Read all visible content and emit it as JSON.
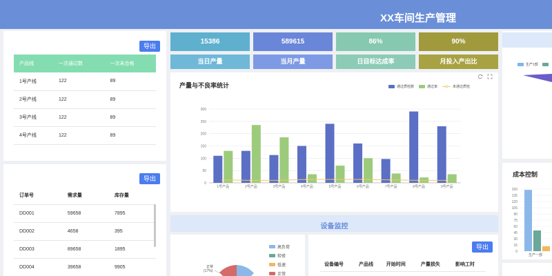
{
  "header": {
    "title": "XX车间生产管理"
  },
  "left_top": {
    "export_label": "导出",
    "columns": [
      "产品线",
      "一次通过数",
      "一次未合格"
    ],
    "rows": [
      [
        "1号产线",
        "122",
        "89"
      ],
      [
        "2号产线",
        "122",
        "89"
      ],
      [
        "3号产线",
        "122",
        "89"
      ],
      [
        "4号产线",
        "122",
        "89"
      ]
    ]
  },
  "left_bottom": {
    "export_label": "导出",
    "columns": [
      "订单号",
      "需求量",
      "库存量"
    ],
    "rows": [
      [
        "DD001",
        "59658",
        "7895"
      ],
      [
        "DD002",
        "4658",
        "395"
      ],
      [
        "DD003",
        "89658",
        "1895"
      ],
      [
        "DD004",
        "39658",
        "9905"
      ]
    ]
  },
  "kpis": [
    {
      "value": "15386",
      "label": "当日产量",
      "color": "#5fb0cf",
      "label_color": "#6fb8d8"
    },
    {
      "value": "589615",
      "label": "当月产量",
      "color": "#6a86d8",
      "label_color": "#7e9ae4"
    },
    {
      "value": "86%",
      "label": "日目标达成率",
      "color": "#86c9b0",
      "label_color": "#8ccbb5"
    },
    {
      "value": "90%",
      "label": "月投入产出比",
      "color": "#a09a3c",
      "label_color": "#a8a242"
    }
  ],
  "main_chart": {
    "title": "产量与不良率统计",
    "refresh_icon": "refresh-icon",
    "expand_icon": "expand-icon"
  },
  "chart_data": {
    "type": "bar",
    "categories": [
      "1号产品",
      "2号产品",
      "3号产品",
      "4号产品",
      "5号产品",
      "6号产品",
      "7号产品",
      "8号产品",
      "9号产品"
    ],
    "series": [
      {
        "name": "通过质检数",
        "type": "bar",
        "color": "#5b6fc4",
        "values": [
          110,
          130,
          113,
          150,
          240,
          160,
          97,
          290,
          230
        ]
      },
      {
        "name": "通过率",
        "type": "bar",
        "color": "#9dcb7c",
        "values": [
          130,
          235,
          185,
          35,
          70,
          100,
          38,
          22,
          35
        ]
      },
      {
        "name": "未通过质检",
        "type": "line",
        "color": "#f0c76a",
        "values": [
          12,
          10,
          10,
          14,
          14,
          14,
          12,
          10,
          10
        ]
      }
    ],
    "ylim": [
      0,
      300
    ],
    "yticks": [
      0,
      50,
      100,
      150,
      200,
      250,
      300
    ],
    "legend": "top-right",
    "grid": true
  },
  "right_top": {
    "legend": [
      {
        "name": "生产1部",
        "color": "#7eb6e8"
      },
      {
        "name": "",
        "color": "#6aa89a"
      }
    ]
  },
  "cost": {
    "title": "成本控制",
    "yticks": [
      "0",
      "15",
      "30",
      "45",
      "60",
      "75",
      "90",
      "105",
      "120",
      "135",
      "150"
    ],
    "xlabel": "生产一部"
  },
  "equipment": {
    "title": "设备监控",
    "export_label": "导出",
    "columns": [
      "设备编号",
      "产品线",
      "开始时间",
      "产量损失",
      "影响工时"
    ]
  },
  "pie": {
    "legend": [
      {
        "name": "高负荷",
        "color": "#8bb8e8"
      },
      {
        "name": "检修",
        "color": "#6aa89a"
      },
      {
        "name": "低速",
        "color": "#f0b860"
      },
      {
        "name": "正常",
        "color": "#d46a6a"
      }
    ],
    "label_name": "正常",
    "label_pct": "(17%)"
  }
}
